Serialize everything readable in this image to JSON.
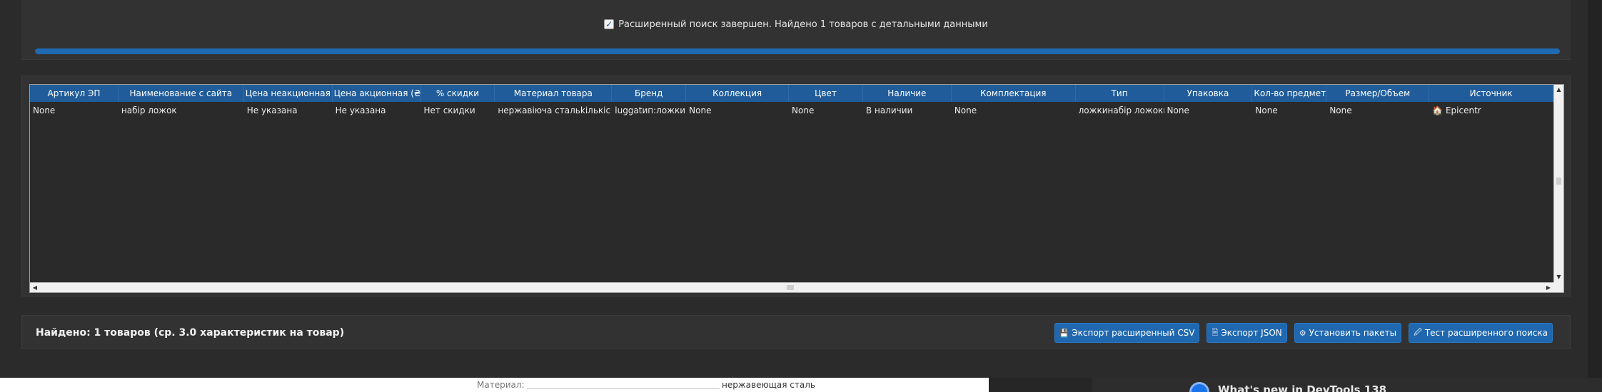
{
  "status": {
    "checkbox_glyph": "✓",
    "message": "Расширенный поиск завершен. Найдено 1 товаров с детальными данными",
    "progress_percent": 100
  },
  "table": {
    "columns": [
      "Артикул ЭП",
      "Наименование с сайта",
      "Цена неакционная (₴",
      "Цена акционная (₴)",
      "% скидки",
      "Материал товара",
      "Бренд",
      "Коллекция",
      "Цвет",
      "Наличие",
      "Комплектация",
      "Тип",
      "Упаковка",
      "Кол-во предмето",
      "Размер/Объем",
      "Источник"
    ],
    "rows": [
      [
        "None",
        "набір ложок",
        "Не указана",
        "Не указана",
        "Нет скидки",
        "нержавіюча стальkількіс",
        "luggatип:ложкинабір",
        "None",
        "None",
        "В наличии",
        "None",
        "ложкинабір ложокм",
        "None",
        "None",
        "None",
        "🏠 Epicentr"
      ]
    ]
  },
  "scrollbars": {
    "up": "▲",
    "down": "▼",
    "left": "◀",
    "right": "▶"
  },
  "footer": {
    "found_text": "Найдено: 1 товаров (ср. 3.0 характеристик на товар)",
    "buttons": [
      {
        "icon": "💾",
        "icon_name": "save-icon",
        "label": "Экспорт расширенный CSV"
      },
      {
        "icon": "🗎",
        "icon_name": "file-icon",
        "label": "Экспорт JSON"
      },
      {
        "icon": "⚙",
        "icon_name": "gear-icon",
        "label": "Установить пакеты"
      },
      {
        "icon": "🖉",
        "icon_name": "pencil-icon",
        "label": "Тест расширенного поиска"
      }
    ]
  },
  "background_page": {
    "label": "Материал:",
    "value": "нержавеющая сталь",
    "devtools_text": "What's new in DevTools 138"
  },
  "colors": {
    "accent": "#1f68b0",
    "header": "#1f5c99",
    "panel": "#323232",
    "window": "#2b2b2b"
  }
}
